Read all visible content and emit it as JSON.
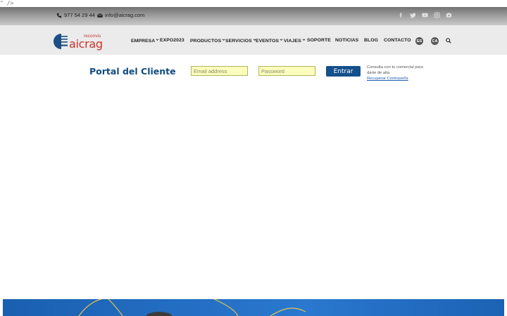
{
  "stray_text": "\" />",
  "topbar": {
    "phone": "977 54 29 44",
    "email": "info@aicrag.com",
    "social": [
      {
        "icon": "facebook-icon"
      },
      {
        "icon": "twitter-icon"
      },
      {
        "icon": "youtube-icon"
      },
      {
        "icon": "instagram-icon"
      },
      {
        "icon": "camera-icon"
      }
    ]
  },
  "logo": {
    "small": "reconvis",
    "word": "aicrag"
  },
  "nav": {
    "items": [
      {
        "label": "EMPRESA",
        "dropdown": true
      },
      {
        "label": "EXPO2023",
        "dropdown": false
      },
      {
        "label": "PRODUCTOS",
        "dropdown": true
      },
      {
        "label": "SERVICIOS",
        "dropdown": true
      },
      {
        "label": "EVENTOS",
        "dropdown": true
      },
      {
        "label": "VIAJES",
        "dropdown": true
      },
      {
        "label": "SOPORTE",
        "dropdown": false
      },
      {
        "label": "NOTICIAS",
        "dropdown": false
      },
      {
        "label": "BLOG",
        "dropdown": false
      },
      {
        "label": "CONTACTO",
        "dropdown": false
      }
    ],
    "languages": [
      "ES",
      "CA"
    ]
  },
  "portal": {
    "title": "Portal del Cliente",
    "email_placeholder": "Email address",
    "password_placeholder": "Password",
    "submit_label": "Entrar",
    "note": "Consulta con tu comercial para darte de alta",
    "recover_label": "Recuperar Contraseña"
  },
  "colors": {
    "accent": "#14508c",
    "title": "#0f4c81",
    "logo_red": "#c8332b",
    "input_bg": "#fbfdbd",
    "banner": "#1a5fb0"
  }
}
